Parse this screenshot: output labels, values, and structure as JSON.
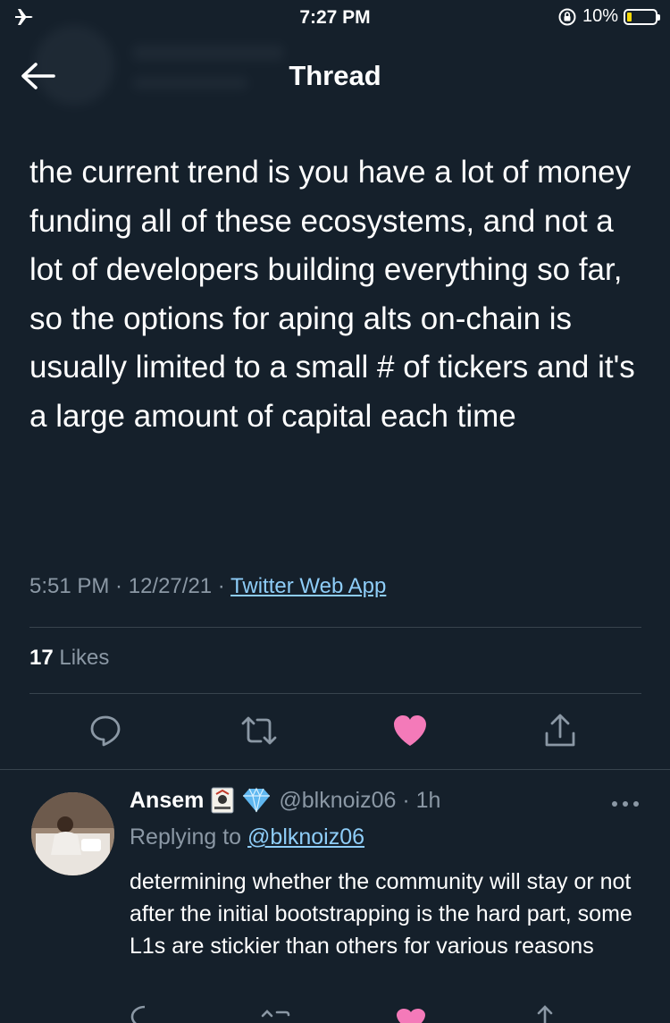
{
  "status_bar": {
    "time": "7:27 PM",
    "battery_percent": "10%"
  },
  "nav": {
    "title": "Thread"
  },
  "tweet": {
    "text": "the current trend is you have a lot of money funding all of these ecosystems, and not a lot of developers building everything so far, so the options for aping alts on-chain is usually limited to a small # of tickers and it's a large amount of capital each time",
    "time": "5:51 PM",
    "sep1": " · ",
    "date": "12/27/21",
    "sep2": " · ",
    "source": "Twitter Web App",
    "likes_count": "17",
    "likes_label": "Likes"
  },
  "reply": {
    "name": "Ansem",
    "handle": "@blknoiz06 · 1h",
    "replying_prefix": "Replying to ",
    "replying_to": "@blknoiz06",
    "text": "determining whether the community will stay or not after the initial bootstrapping is the hard part, some L1s are stickier than others for various reasons"
  },
  "colors": {
    "background": "#15202b",
    "accent": "#8ecdf8",
    "like": "#f47ab9",
    "muted": "#8b98a5"
  },
  "icons": [
    "airplane-icon",
    "orientation-lock-icon",
    "battery-icon",
    "back-arrow-icon",
    "reply-icon",
    "retweet-icon",
    "like-icon",
    "share-icon",
    "more-icon",
    "joker-card-icon",
    "diamond-icon"
  ]
}
